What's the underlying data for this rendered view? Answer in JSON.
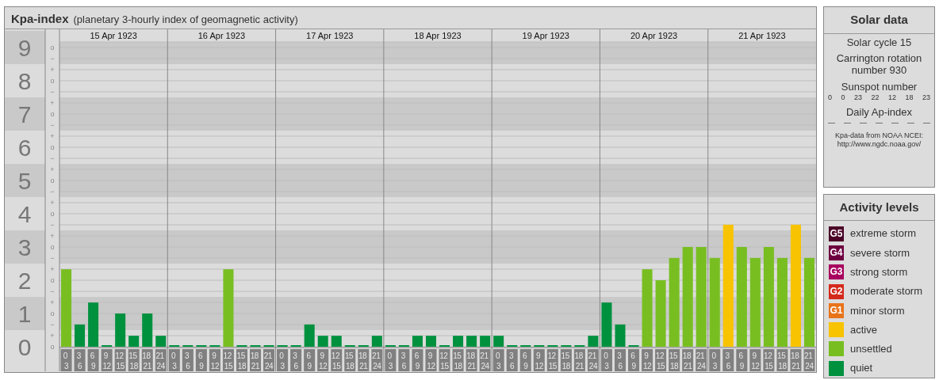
{
  "title": "Kpa-index",
  "subtitle": "(planetary 3-hourly index of geomagnetic activity)",
  "days": [
    "15 Apr 1923",
    "16 Apr 1923",
    "17 Apr 1923",
    "18 Apr 1923",
    "19 Apr 1923",
    "20 Apr 1923",
    "21 Apr 1923"
  ],
  "minor_ticks": [
    "o",
    "−",
    "+",
    "o",
    "−",
    "+",
    "o",
    "−",
    "+",
    "o",
    "−",
    "+",
    "o",
    "−",
    "+",
    "o",
    "−",
    "+",
    "o",
    "−",
    "+",
    "o",
    "−",
    "+",
    "o",
    "−",
    "+",
    "o"
  ],
  "chart_data": {
    "type": "bar",
    "stacked": true,
    "ylim": [
      0,
      9
    ],
    "grid": true,
    "yticks": [
      0,
      1,
      2,
      3,
      4,
      5,
      6,
      7,
      8,
      9
    ],
    "categories": [
      "0 3",
      "3 6",
      "6 9",
      "9 12",
      "12 15",
      "15 18",
      "18 21",
      "21 24",
      "0 3",
      "3 6",
      "6 9",
      "9 12",
      "12 15",
      "15 18",
      "18 21",
      "21 24",
      "0 3",
      "3 6",
      "6 9",
      "9 12",
      "12 15",
      "15 18",
      "18 21",
      "21 24",
      "0 3",
      "3 6",
      "6 9",
      "9 12",
      "12 15",
      "15 18",
      "18 21",
      "21 24",
      "0 3",
      "3 6",
      "6 9",
      "9 12",
      "12 15",
      "15 18",
      "18 21",
      "21 24",
      "0 3",
      "3 6",
      "6 9",
      "9 12",
      "12 15",
      "15 18",
      "18 21",
      "21 24",
      "0 3",
      "3 6",
      "6 9",
      "9 12",
      "12 15",
      "15 18",
      "18 21",
      "21 24"
    ],
    "series": [
      {
        "color": "#00913f",
        "values": [
          null,
          0.67,
          1.33,
          0,
          1,
          0.33,
          1,
          0.33,
          0,
          0,
          0,
          0,
          null,
          0,
          0,
          0,
          0,
          0,
          0.67,
          0.33,
          0.33,
          0,
          0,
          0.33,
          0,
          0,
          0.33,
          0.33,
          0,
          0.33,
          0.33,
          0.33,
          0.33,
          0,
          0,
          0,
          0,
          0,
          0,
          0.33,
          1.33,
          0.67,
          0,
          null,
          null,
          null,
          null,
          null,
          null,
          null,
          null,
          null,
          null,
          null,
          null,
          null
        ]
      },
      {
        "color": "#78be21",
        "values": [
          2.33,
          null,
          null,
          null,
          null,
          null,
          null,
          null,
          null,
          null,
          null,
          null,
          2.33,
          null,
          null,
          null,
          null,
          null,
          null,
          null,
          null,
          null,
          null,
          null,
          null,
          null,
          null,
          null,
          null,
          null,
          null,
          null,
          null,
          null,
          null,
          null,
          null,
          null,
          null,
          null,
          null,
          null,
          null,
          2.33,
          2,
          2.67,
          3,
          3,
          2.67,
          null,
          3,
          2.67,
          3,
          2.67,
          null,
          2.67
        ]
      },
      {
        "color": "#f8c300",
        "values": [
          null,
          null,
          null,
          null,
          null,
          null,
          null,
          null,
          null,
          null,
          null,
          null,
          null,
          null,
          null,
          null,
          null,
          null,
          null,
          null,
          null,
          null,
          null,
          null,
          null,
          null,
          null,
          null,
          null,
          null,
          null,
          null,
          null,
          null,
          null,
          null,
          null,
          null,
          null,
          null,
          null,
          null,
          null,
          null,
          null,
          null,
          null,
          null,
          null,
          3.67,
          null,
          null,
          null,
          null,
          3.67,
          null
        ]
      }
    ]
  },
  "solar": {
    "title": "Solar data",
    "cycle": "Solar cycle 15",
    "carrington": "Carrington rotation number 930",
    "sunspot_label": "Sunspot number",
    "sunspots": [
      "0",
      "0",
      "23",
      "22",
      "12",
      "18",
      "23"
    ],
    "ap_label": "Daily Ap-index",
    "ap": [
      "—",
      "—",
      "—",
      "—",
      "—",
      "—",
      "—"
    ],
    "source": "Kpa-data from NOAA NCEI:",
    "source_url": "http://www.ngdc.noaa.gov/"
  },
  "legend": {
    "title": "Activity levels",
    "items": [
      {
        "badge": "G5",
        "label": "extreme storm",
        "color": "#4a0026"
      },
      {
        "badge": "G4",
        "label": "severe storm",
        "color": "#6e0040"
      },
      {
        "badge": "G3",
        "label": "strong storm",
        "color": "#a8005e"
      },
      {
        "badge": "G2",
        "label": "moderate storm",
        "color": "#d42a1c"
      },
      {
        "badge": "G1",
        "label": "minor storm",
        "color": "#e8741a"
      },
      {
        "label": "active",
        "color": "#f8c300"
      },
      {
        "label": "unsettled",
        "color": "#78be21"
      },
      {
        "label": "quiet",
        "color": "#00913f"
      }
    ]
  }
}
